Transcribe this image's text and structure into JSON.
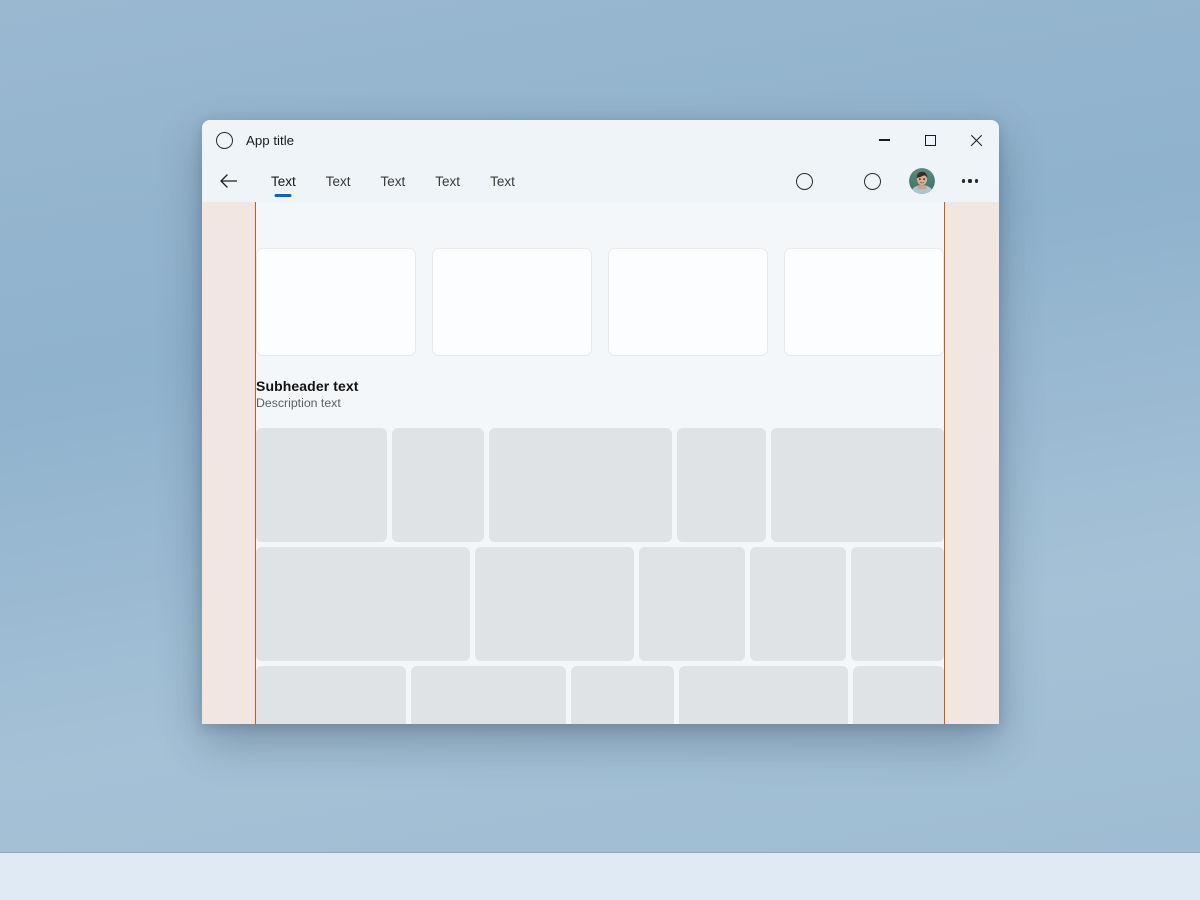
{
  "window": {
    "title": "App title",
    "app_icon": "circle-outline-icon",
    "caption": {
      "minimize_label": "Minimize",
      "maximize_label": "Maximize",
      "close_label": "Close"
    }
  },
  "commandbar": {
    "back_icon": "arrow-left-icon",
    "tabs": [
      {
        "label": "Text",
        "active": true
      },
      {
        "label": "Text",
        "active": false
      },
      {
        "label": "Text",
        "active": false
      },
      {
        "label": "Text",
        "active": false
      },
      {
        "label": "Text",
        "active": false
      }
    ],
    "actions": [
      {
        "icon": "circle-outline-icon"
      },
      {
        "icon": "circle-outline-icon"
      }
    ],
    "avatar_icon": "user-avatar-photo",
    "overflow_icon": "ellipsis-icon",
    "accent_color": "#0067C0"
  },
  "content": {
    "cards": [
      {
        "label": ""
      },
      {
        "label": ""
      },
      {
        "label": ""
      },
      {
        "label": ""
      }
    ],
    "section": {
      "title": "Subheader text",
      "description": "Description text"
    },
    "mosaic_rows": [
      {
        "tiles": [
          {
            "flex": 136
          },
          {
            "flex": 96
          },
          {
            "flex": 190
          },
          {
            "flex": 92
          },
          {
            "flex": 180
          }
        ]
      },
      {
        "tiles": [
          {
            "flex": 216
          },
          {
            "flex": 161
          },
          {
            "flex": 107
          },
          {
            "flex": 97
          },
          {
            "flex": 94
          }
        ]
      },
      {
        "tiles": [
          {
            "flex": 153
          },
          {
            "flex": 158
          },
          {
            "flex": 106
          },
          {
            "flex": 172
          },
          {
            "flex": 93
          }
        ]
      }
    ],
    "background_color": "#F3F7FA",
    "guide_color": "#F2E7E0",
    "guide_border_color": "#D2590D"
  },
  "desktop": {
    "wallpaper_color": "#9AB8D0",
    "taskbar_color": "#DFEAF4"
  }
}
